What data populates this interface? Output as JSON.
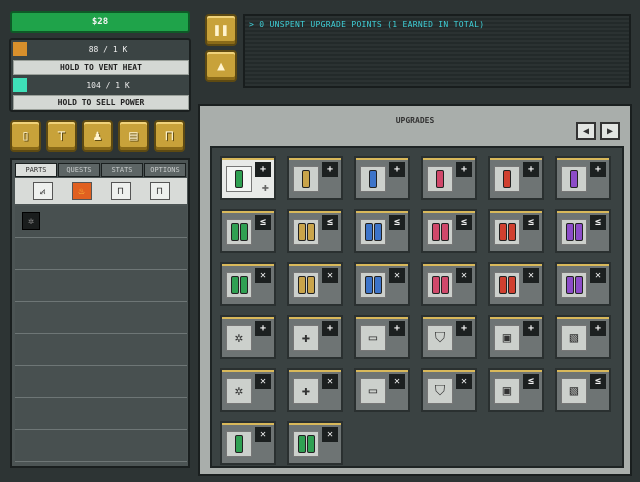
{
  "money": "$28",
  "heat": {
    "value": "88 / 1 K",
    "swatch_color": "#d8902c",
    "button": "HOLD TO VENT HEAT"
  },
  "power": {
    "value": "104 / 1 K",
    "swatch_color": "#3ee0b8",
    "button": "HOLD TO SELL POWER"
  },
  "tools": [
    "cell-icon",
    "vent-icon",
    "person-icon",
    "document-icon",
    "lock-icon"
  ],
  "tabs": [
    {
      "label": "PARTS",
      "active": true
    },
    {
      "label": "QUESTS",
      "active": false
    },
    {
      "label": "STATS",
      "active": false
    },
    {
      "label": "OPTIONS",
      "active": false
    }
  ],
  "subtabs": [
    "heat-gauge-icon",
    "fire-icon",
    "locked-icon",
    "locked-icon"
  ],
  "parts_list": {
    "rows": 8,
    "first_item": "capacitor-part-icon"
  },
  "message": "> 0 UNSPENT UPGRADE POINTS (1 EARNED IN TOTAL)",
  "upgrades": {
    "title": "UPGRADES",
    "rows": [
      [
        {
          "color": "#2fa052",
          "badge": "+",
          "selected": true
        },
        {
          "color": "#c9a44a",
          "badge": "+"
        },
        {
          "color": "#3d74c9",
          "badge": "+"
        },
        {
          "color": "#d0486a",
          "badge": "+"
        },
        {
          "color": "#d0402f",
          "badge": "+"
        },
        {
          "color": "#8c4cc8",
          "badge": "+"
        }
      ],
      [
        {
          "color": "#2fa052",
          "badge": "≤"
        },
        {
          "color": "#c9a44a",
          "badge": "≤"
        },
        {
          "color": "#3d74c9",
          "badge": "≤"
        },
        {
          "color": "#d0486a",
          "badge": "≤"
        },
        {
          "color": "#d0402f",
          "badge": "≤"
        },
        {
          "color": "#8c4cc8",
          "badge": "≤"
        }
      ],
      [
        {
          "color": "#2fa052",
          "badge": "✕"
        },
        {
          "color": "#c9a44a",
          "badge": "✕"
        },
        {
          "color": "#3d74c9",
          "badge": "✕"
        },
        {
          "color": "#d0486a",
          "badge": "✕"
        },
        {
          "color": "#d0402f",
          "badge": "✕"
        },
        {
          "color": "#8c4cc8",
          "badge": "✕"
        }
      ],
      [
        {
          "gear": "✲",
          "badge": "+"
        },
        {
          "gear": "✚",
          "badge": "+"
        },
        {
          "gear": "▭",
          "badge": "+"
        },
        {
          "gear": "⛉",
          "badge": "+"
        },
        {
          "gear": "▣",
          "badge": "+"
        },
        {
          "gear": "▧",
          "badge": "+"
        }
      ],
      [
        {
          "gear": "✲",
          "badge": "✕"
        },
        {
          "gear": "✚",
          "badge": "✕"
        },
        {
          "gear": "▭",
          "badge": "✕"
        },
        {
          "gear": "⛉",
          "badge": "✕"
        },
        {
          "gear": "▣",
          "badge": "≤"
        },
        {
          "gear": "▧",
          "badge": "≤"
        }
      ],
      [
        {
          "color": "#2fa052",
          "badge": "✕"
        },
        {
          "color": "#2fa052",
          "badge": "✕"
        }
      ]
    ]
  }
}
